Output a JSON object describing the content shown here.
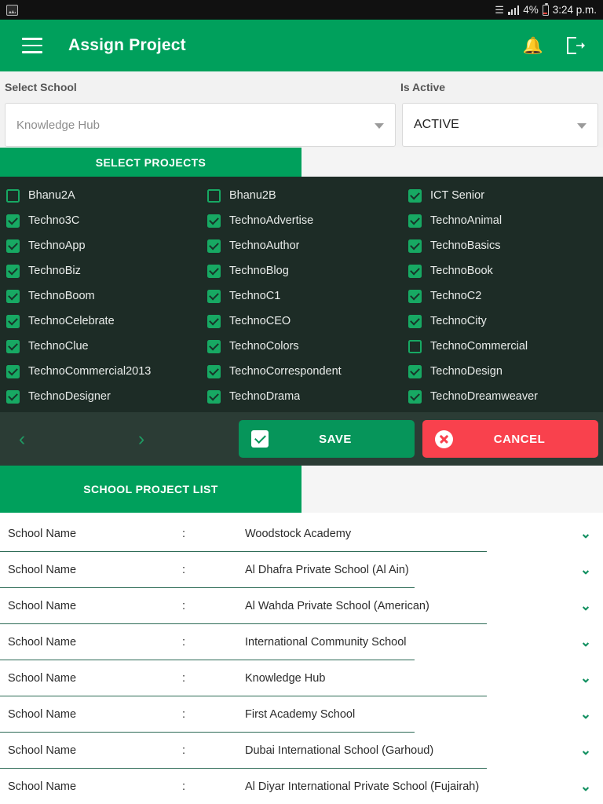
{
  "statusbar": {
    "left_icon": "image-icon",
    "wifi_icon": "wifi-icon",
    "signal_icon": "cellular-signal-icon",
    "battery_percent": "4%",
    "battery_icon": "battery-low-icon",
    "clock": "3:24 p.m."
  },
  "appbar": {
    "menu_icon": "hamburger-menu-icon",
    "title": "Assign Project",
    "bell_icon": "notifications-bell-icon",
    "logout_icon": "logout-icon"
  },
  "filters": {
    "school_label": "Select School",
    "school_value": "Knowledge Hub",
    "active_label": "Is Active",
    "active_value": "ACTIVE",
    "caret_icon": "chevron-down-icon"
  },
  "projects_tab": {
    "label": "SELECT PROJECTS"
  },
  "projects": [
    {
      "label": "Bhanu2A",
      "checked": false
    },
    {
      "label": "Bhanu2B",
      "checked": false
    },
    {
      "label": "ICT Senior",
      "checked": true
    },
    {
      "label": "Techno3C",
      "checked": true
    },
    {
      "label": "TechnoAdvertise",
      "checked": true
    },
    {
      "label": "TechnoAnimal",
      "checked": true
    },
    {
      "label": "TechnoApp",
      "checked": true
    },
    {
      "label": "TechnoAuthor",
      "checked": true
    },
    {
      "label": "TechnoBasics",
      "checked": true
    },
    {
      "label": "TechnoBiz",
      "checked": true
    },
    {
      "label": "TechnoBlog",
      "checked": true
    },
    {
      "label": "TechnoBook",
      "checked": true
    },
    {
      "label": "TechnoBoom",
      "checked": true
    },
    {
      "label": "TechnoC1",
      "checked": true
    },
    {
      "label": "TechnoC2",
      "checked": true
    },
    {
      "label": "TechnoCelebrate",
      "checked": true
    },
    {
      "label": "TechnoCEO",
      "checked": true
    },
    {
      "label": "TechnoCity",
      "checked": true
    },
    {
      "label": "TechnoClue",
      "checked": true
    },
    {
      "label": "TechnoColors",
      "checked": true
    },
    {
      "label": "TechnoCommercial",
      "checked": false
    },
    {
      "label": "TechnoCommercial2013",
      "checked": true
    },
    {
      "label": "TechnoCorrespondent",
      "checked": true
    },
    {
      "label": "TechnoDesign",
      "checked": true
    },
    {
      "label": "TechnoDesigner",
      "checked": true
    },
    {
      "label": "TechnoDrama",
      "checked": true
    },
    {
      "label": "TechnoDreamweaver",
      "checked": true
    },
    {
      "label": "",
      "checked": true
    },
    {
      "label": "",
      "checked": true
    },
    {
      "label": "",
      "checked": true
    }
  ],
  "pager": {
    "prev_icon": "chevron-left-icon",
    "prev_label": "‹",
    "next_icon": "chevron-right-icon",
    "next_label": "›"
  },
  "actions": {
    "save_label": "SAVE",
    "save_icon": "checkbox-checked-icon",
    "cancel_label": "CANCEL",
    "cancel_icon": "circle-x-icon"
  },
  "list_tab": {
    "label": "SCHOOL PROJECT LIST"
  },
  "school_list": {
    "row_label": "School Name",
    "separator": ":",
    "chevron_icon": "chevron-down-icon",
    "chevron_glyph": "⌄",
    "rows": [
      {
        "label": "School Name",
        "separator": ":",
        "value": "Woodstock Academy",
        "rule_width": 620
      },
      {
        "label": "School Name",
        "separator": ":",
        "value": "Al Dhafra Private School (Al Ain)",
        "rule_width": 528
      },
      {
        "label": "School Name",
        "separator": ":",
        "value": "Al Wahda Private School (American)",
        "rule_width": 620
      },
      {
        "label": "School Name",
        "separator": ":",
        "value": "International Community School",
        "rule_width": 528
      },
      {
        "label": "School Name",
        "separator": ":",
        "value": "Knowledge Hub",
        "rule_width": 620
      },
      {
        "label": "School Name",
        "separator": ":",
        "value": "First Academy School",
        "rule_width": 528
      },
      {
        "label": "School Name",
        "separator": ":",
        "value": "Dubai International School (Garhoud)",
        "rule_width": 620
      },
      {
        "label": "School Name",
        "separator": ":",
        "value": "Al Diyar International Private School (Fujairah)",
        "rule_width": 620
      }
    ]
  },
  "colors": {
    "brand_green": "#00a05c",
    "panel_dark": "#1d2c26",
    "action_dark": "#2b3c35",
    "checkbox_green": "#17a963",
    "cancel_red": "#f9414d",
    "rule_teal": "#2c6a55"
  }
}
